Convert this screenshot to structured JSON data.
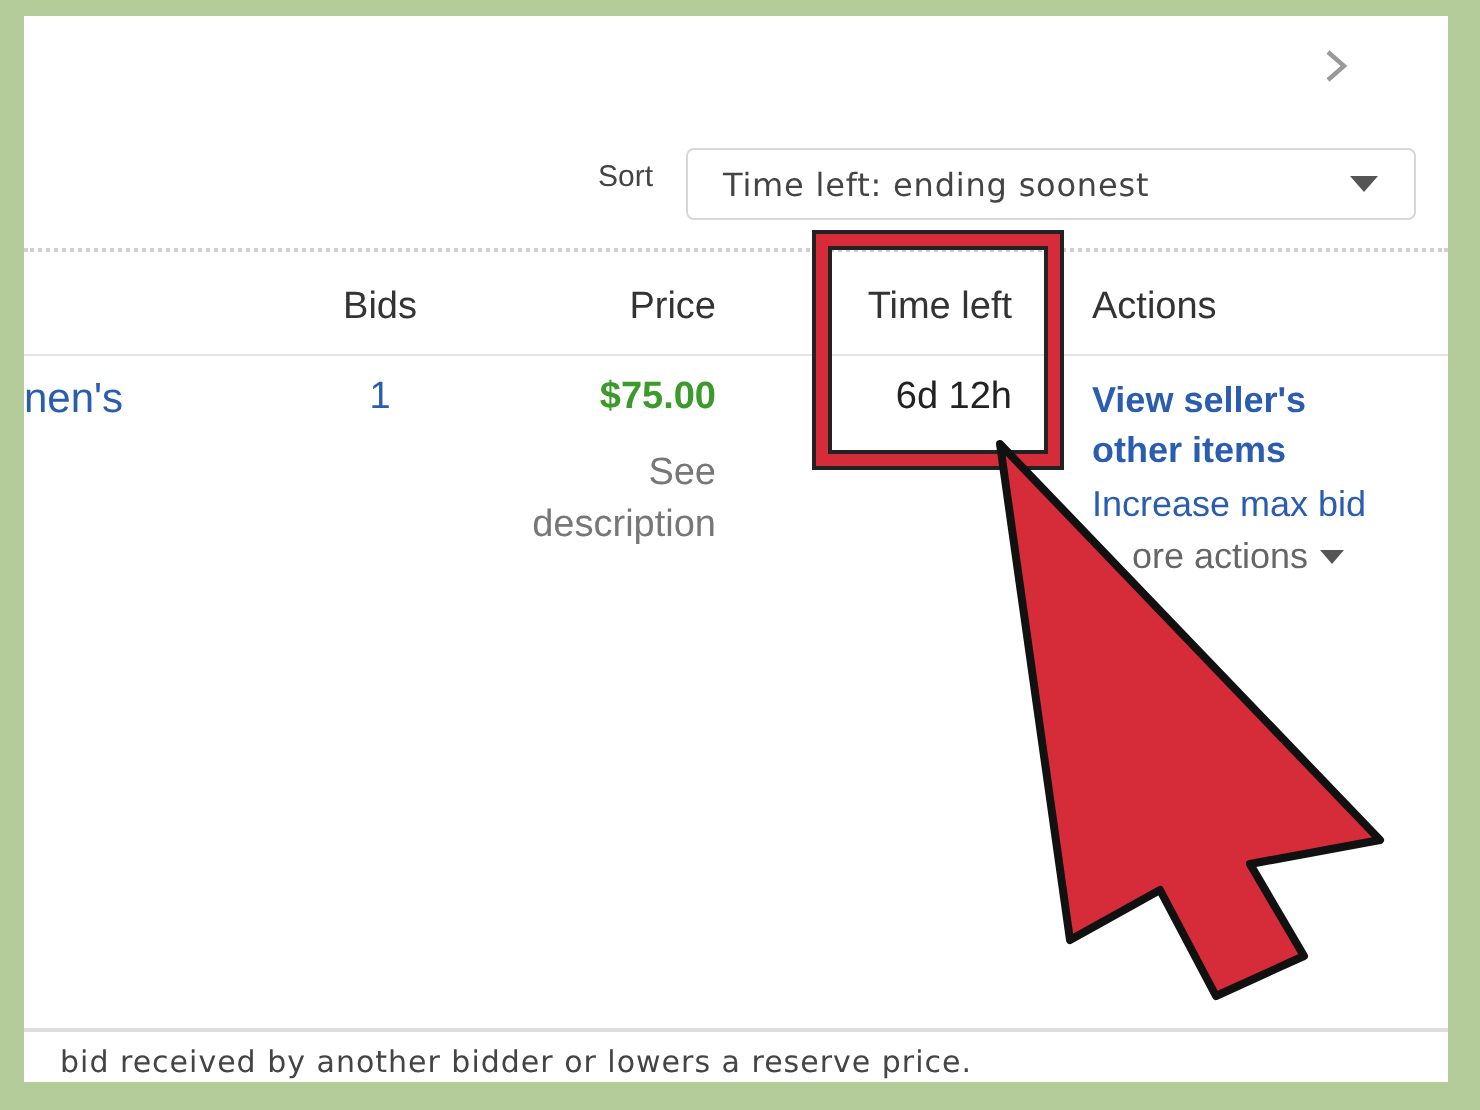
{
  "sort": {
    "label": "Sort",
    "value": "Time left: ending soonest"
  },
  "table": {
    "columns": [
      "Bids",
      "Price",
      "Time left",
      "Actions"
    ],
    "rows": [
      {
        "item": "nen's",
        "bids": "1",
        "price": "$75.00",
        "price_note": "See description",
        "time_left": "6d 12h",
        "actions": [
          {
            "kind": "strong_link",
            "label": "View seller's other items"
          },
          {
            "kind": "link",
            "label": "Increase max bid"
          },
          {
            "kind": "menu",
            "label": "ore actions"
          }
        ]
      }
    ]
  },
  "footer_note": "bid received by another bidder or lowers a reserve price."
}
